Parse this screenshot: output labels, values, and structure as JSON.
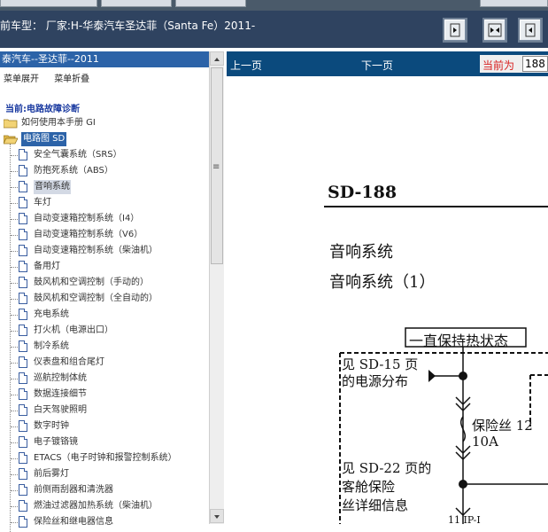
{
  "header": {
    "title": "前车型：  厂家:H-华泰汽车圣达菲（Santa Fe）2011-"
  },
  "left_panel": {
    "title": "泰汽车--圣达菲--2011",
    "menu_expand": "菜单展开",
    "menu_collapse": "菜单折叠",
    "current_label": "当前:电路故障诊断",
    "tree": [
      {
        "label": "如何使用本手册 GI",
        "type": "folder",
        "level": 0
      },
      {
        "label": "电路图 SD",
        "type": "folder-open",
        "level": 0,
        "state": "highlight"
      },
      {
        "label": "安全气囊系统（SRS）",
        "type": "doc",
        "level": 1
      },
      {
        "label": "防抱死系统（ABS）",
        "type": "doc",
        "level": 1
      },
      {
        "label": "音响系统",
        "type": "doc",
        "level": 1,
        "state": "selected"
      },
      {
        "label": "车灯",
        "type": "doc",
        "level": 1
      },
      {
        "label": "自动变速箱控制系统（I4）",
        "type": "doc",
        "level": 1
      },
      {
        "label": "自动变速箱控制系统（V6）",
        "type": "doc",
        "level": 1
      },
      {
        "label": "自动变速箱控制系统（柴油机）",
        "type": "doc",
        "level": 1
      },
      {
        "label": "备用灯",
        "type": "doc",
        "level": 1
      },
      {
        "label": "鼓风机和空调控制（手动的）",
        "type": "doc",
        "level": 1
      },
      {
        "label": "鼓风机和空调控制（全自动的）",
        "type": "doc",
        "level": 1
      },
      {
        "label": "充电系统",
        "type": "doc",
        "level": 1
      },
      {
        "label": "打火机（电源出口）",
        "type": "doc",
        "level": 1
      },
      {
        "label": "制冷系统",
        "type": "doc",
        "level": 1
      },
      {
        "label": "仪表盘和组合尾灯",
        "type": "doc",
        "level": 1
      },
      {
        "label": "巡航控制体统",
        "type": "doc",
        "level": 1
      },
      {
        "label": "数据连接细节",
        "type": "doc",
        "level": 1
      },
      {
        "label": "白天驾驶照明",
        "type": "doc",
        "level": 1
      },
      {
        "label": "数字时钟",
        "type": "doc",
        "level": 1
      },
      {
        "label": "电子镀铬镜",
        "type": "doc",
        "level": 1
      },
      {
        "label": "ETACS（电子时钟和报警控制系统）",
        "type": "doc",
        "level": 1
      },
      {
        "label": "前后雾灯",
        "type": "doc",
        "level": 1
      },
      {
        "label": "前侧雨刮器和清洗器",
        "type": "doc",
        "level": 1
      },
      {
        "label": "燃油过滤器加热系统（柴油机）",
        "type": "doc",
        "level": 1
      },
      {
        "label": "保险丝和继电器信息",
        "type": "doc",
        "level": 1
      }
    ],
    "scroll_position": 0.0
  },
  "right_panel": {
    "prev_page": "上一页",
    "next_page": "下一页",
    "current_label": "当前为",
    "current_page": "188",
    "doc": {
      "code": "SD-188",
      "title_line1": "音响系统",
      "title_line2": "音响系统（1）",
      "diagram": {
        "header": "一直保持热状态",
        "ref1_line1": "见 SD-15 页",
        "ref1_line2": "的电源分布",
        "fuse_label": "保险丝 12",
        "fuse_amp": "10A",
        "ref2_line1": "见 SD-22 页的",
        "ref2_line2": "客舱保险",
        "ref2_line3": "丝详细信息",
        "bottom_label": "11 IP-I"
      }
    }
  },
  "colors": {
    "header_bg": "#2f4360",
    "right_bar_bg": "#0b4a7d",
    "left_title_bg": "#2c63a8",
    "current_text": "#d81e1e"
  }
}
